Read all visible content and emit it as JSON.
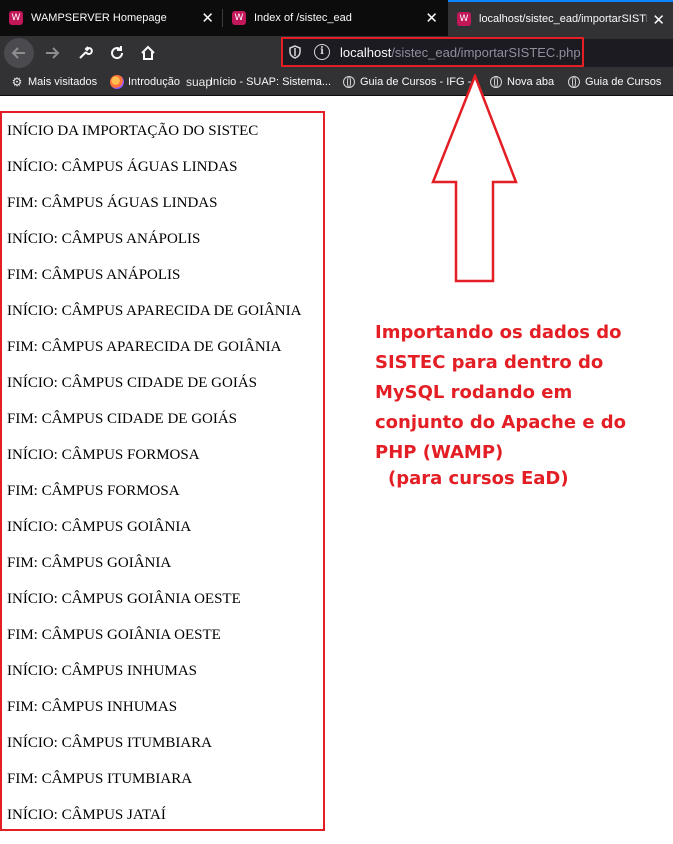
{
  "tabs": [
    {
      "title": "WAMPSERVER Homepage",
      "favicon": "wamp-icon",
      "close": "✕"
    },
    {
      "title": "Index of /sistec_ead",
      "favicon": "wamp-icon",
      "close": "✕"
    },
    {
      "title": "localhost/sistec_ead/importarSISTEC.php",
      "favicon": "wamp-icon",
      "close": "✕"
    }
  ],
  "nav": {
    "url_host": "localhost",
    "url_path": "/sistec_ead/importarSISTEC.php"
  },
  "bookmarks": [
    {
      "label": "Mais visitados",
      "icon": "gear-icon"
    },
    {
      "label": "Introdução",
      "icon": "firefox-icon"
    },
    {
      "label": "Início - SUAP: Sistema...",
      "icon": "suap-icon",
      "icon_text": "suap"
    },
    {
      "label": "Guia de Cursos - IFG -...",
      "icon": "globe-icon"
    },
    {
      "label": "Nova aba",
      "icon": "globe-icon"
    },
    {
      "label": "Guia de Cursos",
      "icon": "globe-icon"
    }
  ],
  "page": {
    "lines": [
      "INÍCIO DA IMPORTAÇÃO DO SISTEC",
      "INÍCIO: CÂMPUS ÁGUAS LINDAS",
      "FIM: CÂMPUS ÁGUAS LINDAS",
      "INÍCIO: CÂMPUS ANÁPOLIS",
      "FIM: CÂMPUS ANÁPOLIS",
      "INÍCIO: CÂMPUS APARECIDA DE GOIÂNIA",
      "FIM: CÂMPUS APARECIDA DE GOIÂNIA",
      "INÍCIO: CÂMPUS CIDADE DE GOIÁS",
      "FIM: CÂMPUS CIDADE DE GOIÁS",
      "INÍCIO: CÂMPUS FORMOSA",
      "FIM: CÂMPUS FORMOSA",
      "INÍCIO: CÂMPUS GOIÂNIA",
      "FIM: CÂMPUS GOIÂNIA",
      "INÍCIO: CÂMPUS GOIÂNIA OESTE",
      "FIM: CÂMPUS GOIÂNIA OESTE",
      "INÍCIO: CÂMPUS INHUMAS",
      "FIM: CÂMPUS INHUMAS",
      "INÍCIO: CÂMPUS ITUMBIARA",
      "FIM: CÂMPUS ITUMBIARA",
      "INÍCIO: CÂMPUS JATAÍ"
    ]
  },
  "annotation": {
    "text": "Importando os dados do SISTEC para dentro do MySQL rodando em conjunto do Apache e do PHP (WAMP)",
    "subtext": "(para cursos EaD)",
    "color": "#e31e24"
  },
  "colors": {
    "tabbar": "#0c0c0d",
    "toolbar": "#323234",
    "accent": "#0a84ff",
    "highlight": "#e31e24"
  }
}
